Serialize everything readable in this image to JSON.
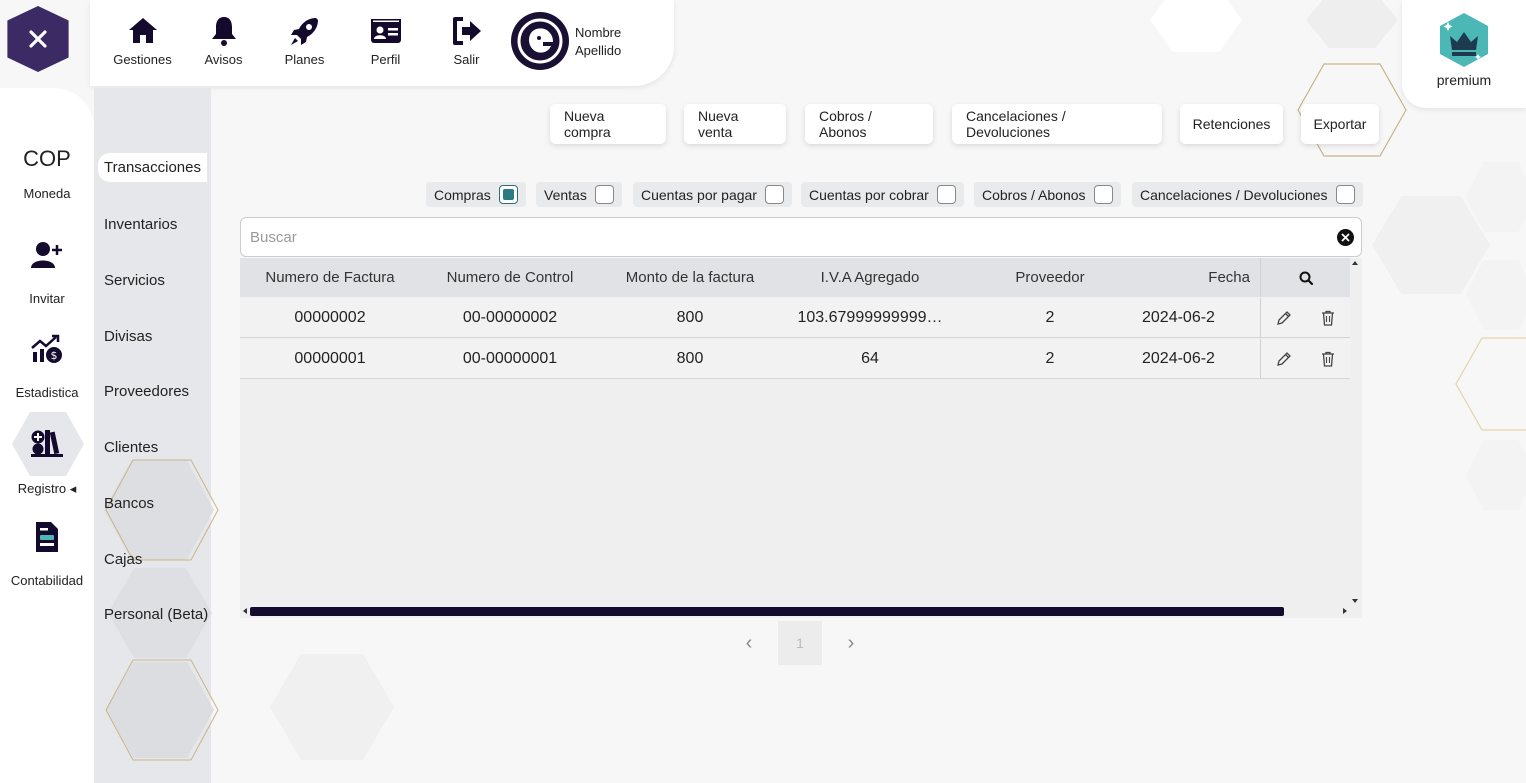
{
  "nav": {
    "items": [
      {
        "label": "Gestiones",
        "icon": "home-icon"
      },
      {
        "label": "Avisos",
        "icon": "bell-icon"
      },
      {
        "label": "Planes",
        "icon": "rocket-icon"
      },
      {
        "label": "Perfil",
        "icon": "id-card-icon"
      },
      {
        "label": "Salir",
        "icon": "logout-icon"
      }
    ],
    "user_first": "Nombre",
    "user_last": "Apellido"
  },
  "premium": {
    "label": "premium"
  },
  "rail": {
    "currency_code": "COP",
    "currency_label": "Moneda",
    "invite_label": "Invitar",
    "stats_label": "Estadistica",
    "register_label": "Registro ◂",
    "accounting_label": "Contabilidad"
  },
  "submenu": {
    "items": [
      "Transacciones",
      "Inventarios",
      "Servicios",
      "Divisas",
      "Proveedores",
      "Clientes",
      "Bancos",
      "Cajas",
      "Personal (Beta)"
    ],
    "active": "Transacciones"
  },
  "actions": [
    "Nueva compra",
    "Nueva venta",
    "Cobros / Abonos",
    "Cancelaciones / Devoluciones",
    "Retenciones",
    "Exportar"
  ],
  "filters": [
    {
      "label": "Compras",
      "checked": true
    },
    {
      "label": "Ventas",
      "checked": false
    },
    {
      "label": "Cuentas por pagar",
      "checked": false
    },
    {
      "label": "Cuentas por cobrar",
      "checked": false
    },
    {
      "label": "Cobros / Abonos",
      "checked": false
    },
    {
      "label": "Cancelaciones / Devoluciones",
      "checked": false
    }
  ],
  "search": {
    "placeholder": "Buscar",
    "value": ""
  },
  "table": {
    "columns": [
      "Numero de Factura",
      "Numero de Control",
      "Monto de la factura",
      "I.V.A Agregado",
      "Proveedor",
      "Fecha"
    ],
    "rows": [
      [
        "00000002",
        "00-00000002",
        "800",
        "103.67999999999…",
        "2",
        "2024-06-2"
      ],
      [
        "00000001",
        "00-00000001",
        "800",
        "64",
        "2",
        "2024-06-2"
      ]
    ]
  },
  "pagination": {
    "current": "1",
    "prev": "‹",
    "next": "›"
  },
  "colors": {
    "brand_dark": "#140a2e",
    "accent_teal": "#2c7a84",
    "brand_purple": "#3b2a63"
  }
}
